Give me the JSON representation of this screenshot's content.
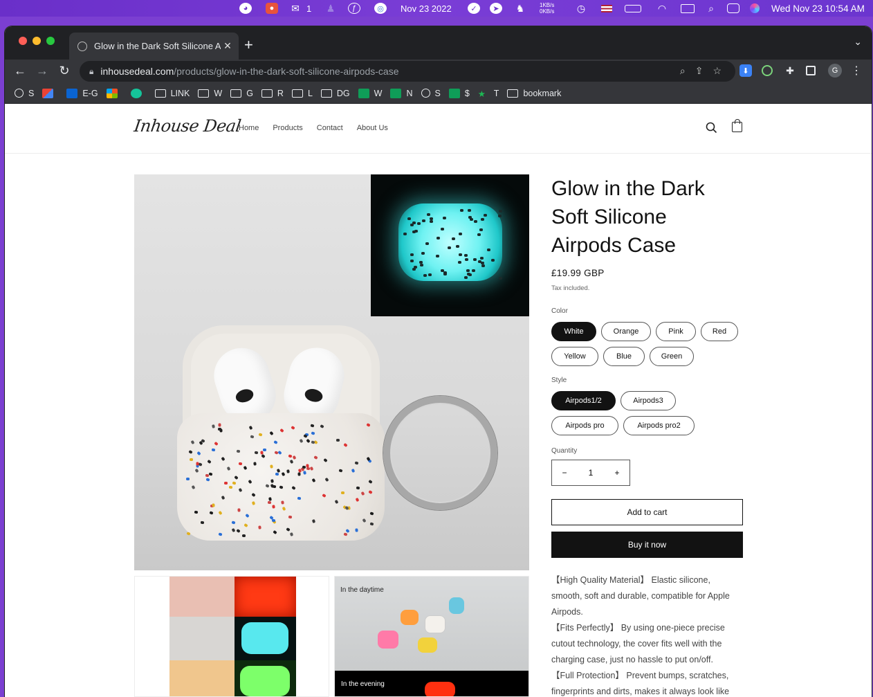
{
  "menubar": {
    "date": "Nov 23 2022",
    "wechat_count": "1",
    "net_up": "1KB/s",
    "net_down": "0KB/s",
    "clock": "Wed Nov 23  10:54 AM"
  },
  "browser": {
    "tab_title": "Glow in the Dark Soft Silicone Airpods Case",
    "url_host": "inhousedeal.com",
    "url_path": "/products/glow-in-the-dark-soft-silicone-airpods-case",
    "profile_initial": "G",
    "bookmarks": [
      {
        "label": "S",
        "icon": "globe-icon"
      },
      {
        "label": "",
        "icon": "gmail-icon"
      },
      {
        "label": "E-G",
        "icon": "outlook-icon"
      },
      {
        "label": "",
        "icon": "microsoft-icon"
      },
      {
        "label": "",
        "icon": "grammarly-icon"
      },
      {
        "label": "LINK",
        "icon": "folder-icon"
      },
      {
        "label": "W",
        "icon": "folder-icon"
      },
      {
        "label": "G",
        "icon": "folder-icon"
      },
      {
        "label": "R",
        "icon": "folder-icon"
      },
      {
        "label": "L",
        "icon": "folder-icon"
      },
      {
        "label": "DG",
        "icon": "folder-icon"
      },
      {
        "label": "W",
        "icon": "sheets-icon"
      },
      {
        "label": "N",
        "icon": "sheets-icon"
      },
      {
        "label": "S",
        "icon": "globe-icon"
      },
      {
        "label": "$",
        "icon": "sheets-icon"
      },
      {
        "label": "T",
        "icon": "star-icon"
      },
      {
        "label": "bookmark",
        "icon": "folder-icon"
      }
    ]
  },
  "site": {
    "logo": "Inhouse Deal",
    "nav": [
      "Home",
      "Products",
      "Contact",
      "About Us"
    ]
  },
  "product": {
    "title": "Glow in the Dark Soft Silicone Airpods Case",
    "price": "£19.99 GBP",
    "tax_note": "Tax included.",
    "color_label": "Color",
    "colors": [
      "White",
      "Orange",
      "Pink",
      "Red",
      "Yellow",
      "Blue",
      "Green"
    ],
    "selected_color": "White",
    "style_label": "Style",
    "styles": [
      "Airpods1/2",
      "Airpods3",
      "Airpods pro",
      "Airpods pro2"
    ],
    "selected_style": "Airpods1/2",
    "quantity_label": "Quantity",
    "quantity": "1",
    "add_to_cart": "Add to cart",
    "buy_now": "Buy it now",
    "description": [
      "【High Quality Material】 Elastic silicone, smooth, soft and durable, compatible for Apple Airpods.",
      "【Fits Perfectly】 By using one-piece precise cutout technology, the cover fits well with the charging case, just no hassle to put on/off.",
      "【Full Protection】 Prevent bumps, scratches, fingerprints and dirts, makes it always look like"
    ],
    "thumb2_labels": {
      "day": "In the daytime",
      "night": "In the evening"
    }
  },
  "colors": {
    "accent_dark": "#121212",
    "chrome_bg": "#35363a",
    "glow": "#6ff2f2"
  }
}
